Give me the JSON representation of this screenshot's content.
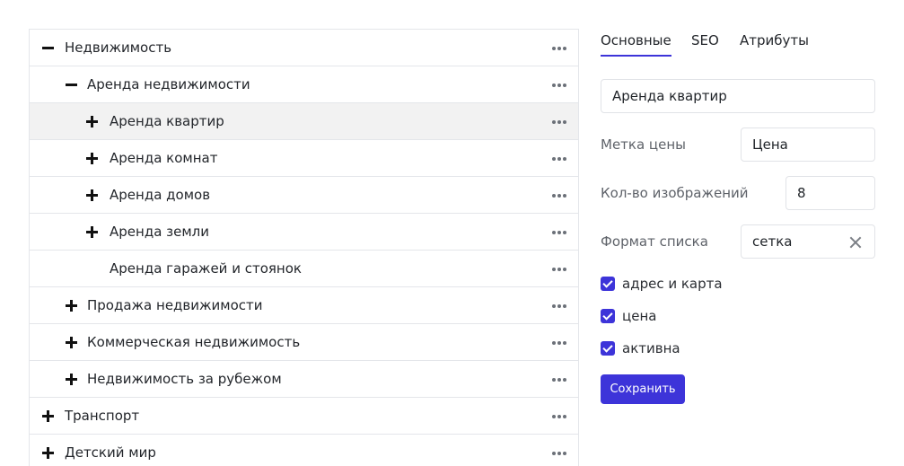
{
  "tree": {
    "rows": [
      {
        "label": "Недвижимость",
        "toggle": "minus-icon"
      },
      {
        "label": "Аренда недвижимости",
        "toggle": "minus-icon"
      },
      {
        "label": "Аренда квартир",
        "toggle": "plus-icon"
      },
      {
        "label": "Аренда комнат",
        "toggle": "plus-icon"
      },
      {
        "label": "Аренда домов",
        "toggle": "plus-icon"
      },
      {
        "label": "Аренда земли",
        "toggle": "plus-icon"
      },
      {
        "label": "Аренда гаражей и стоянок",
        "toggle": ""
      },
      {
        "label": "Продажа недвижимости",
        "toggle": "plus-icon"
      },
      {
        "label": "Коммерческая недвижимость",
        "toggle": "plus-icon"
      },
      {
        "label": "Недвижимость за рубежом",
        "toggle": "plus-icon"
      },
      {
        "label": "Транспорт",
        "toggle": "plus-icon"
      },
      {
        "label": "Детский мир",
        "toggle": "plus-icon"
      }
    ]
  },
  "tabs": [
    {
      "label": "Основные",
      "active": true
    },
    {
      "label": "SEO",
      "active": false
    },
    {
      "label": "Атрибуты",
      "active": false
    }
  ],
  "form": {
    "name_value": "Аренда квартир",
    "price_label": "Метка цены",
    "price_value": "Цена",
    "images_label": "Кол-во изображений",
    "images_value": "8",
    "list_format_label": "Формат списка",
    "list_format_value": "сетка",
    "checkboxes": [
      {
        "label": "адрес и карта",
        "checked": true
      },
      {
        "label": "цена",
        "checked": true
      },
      {
        "label": "активна",
        "checked": true
      }
    ],
    "save_label": "Сохранить"
  },
  "colors": {
    "accent": "#3d34d9",
    "selected_row": "#f2f2f2",
    "border": "#e4e6ea"
  }
}
